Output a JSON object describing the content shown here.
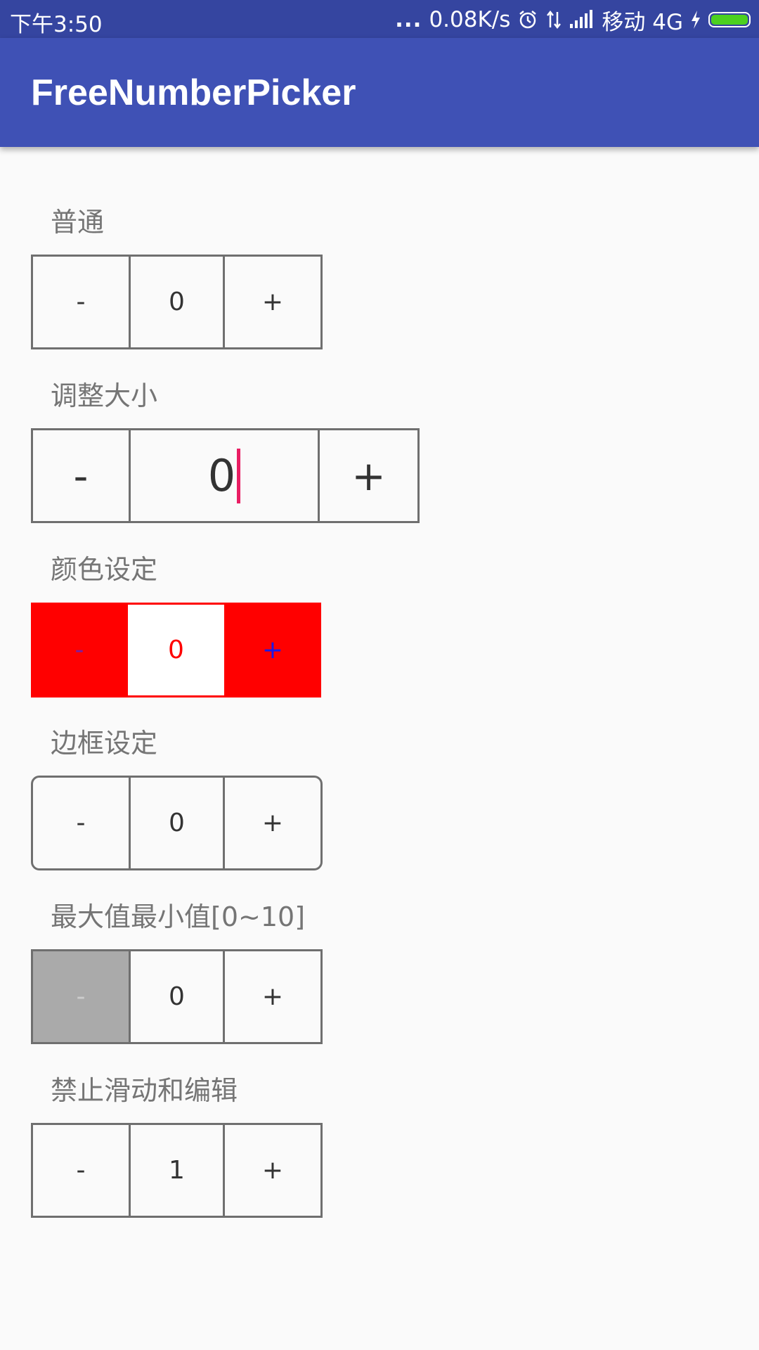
{
  "status_bar": {
    "time": "下午3:50",
    "dots": "...",
    "speed": "0.08K/s",
    "carrier": "移动 4G",
    "icons": [
      "alarm-icon",
      "data-transfer-icon",
      "signal-icon",
      "charging-icon",
      "battery-icon"
    ],
    "battery_color": "#4cd020"
  },
  "app_bar": {
    "title": "FreeNumberPicker",
    "color": "#3f51b5"
  },
  "sections": [
    {
      "label": "普通",
      "minus": "-",
      "value": "0",
      "plus": "+"
    },
    {
      "label": "调整大小",
      "minus": "-",
      "value": "0",
      "plus": "+"
    },
    {
      "label": "颜色设定",
      "minus": "-",
      "value": "0",
      "plus": "+",
      "background_color": "#ff0000",
      "value_color": "#ff0000",
      "minus_color": "#7b1fa2",
      "plus_color": "#1a1ae6"
    },
    {
      "label": "边框设定",
      "minus": "-",
      "value": "0",
      "plus": "+"
    },
    {
      "label": "最大值最小值[0~10]",
      "minus": "-",
      "value": "0",
      "plus": "+",
      "minus_disabled": true
    },
    {
      "label": "禁止滑动和编辑",
      "minus": "-",
      "value": "1",
      "plus": "+"
    }
  ]
}
